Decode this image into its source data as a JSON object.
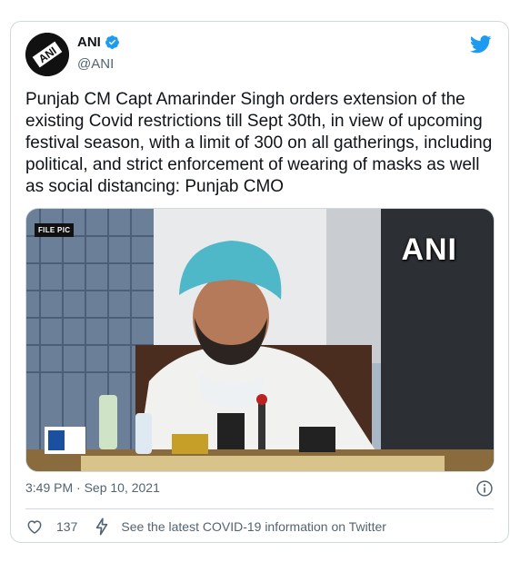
{
  "tweet": {
    "author_name": "ANI",
    "author_handle": "@ANI",
    "text": "Punjab CM Capt Amarinder Singh orders extension of the existing Covid restrictions till Sept 30th, in view of upcoming festival season, with a limit of 300 on all gatherings, including political, and strict enforcement of wearing of masks as well as social distancing: Punjab CMO",
    "timestamp": "3:49 PM · Sep 10, 2021",
    "like_count": "137",
    "covid_info_link": "See the latest COVID-19 information on Twitter"
  },
  "media": {
    "badge": "FILE PIC",
    "watermark": "ANI"
  },
  "avatar": {
    "logo_text": "ANI"
  },
  "colors": {
    "verified_blue": "#1d9bf0",
    "twitter_blue": "#1d9bf0",
    "text_secondary": "#536471",
    "border": "#cfd9de"
  },
  "icons": [
    "avatar-logo",
    "verified-badge-icon",
    "twitter-bird-icon",
    "info-icon",
    "heart-icon",
    "lightning-bolt-icon"
  ]
}
